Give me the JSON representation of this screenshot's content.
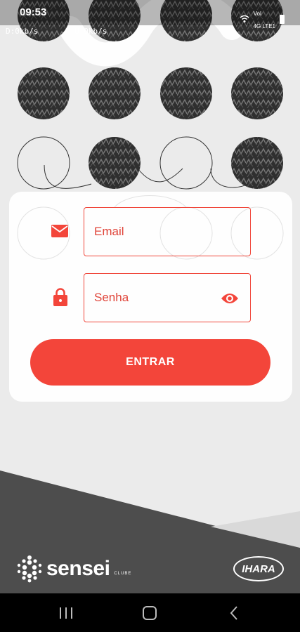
{
  "status_bar": {
    "time": "09:53",
    "network_label_top": "VoI",
    "network_label_bottom": "4G LTE1",
    "download_speed": "D:0kb/s",
    "upload_speed": "U:0kb/s"
  },
  "login_form": {
    "email_placeholder": "Email",
    "password_placeholder": "Senha",
    "submit_label": "ENTRAR"
  },
  "footer": {
    "sensei_logo_text": "sensei",
    "sensei_logo_sub": "CLUBE",
    "ihara_logo_text": "IHARA"
  },
  "colors": {
    "accent": "#f3453a",
    "footer_gray": "#4d4d4d",
    "background": "#ebebeb"
  },
  "icons": {
    "email": "mail-icon",
    "password": "lock-icon",
    "show_password": "eye-icon",
    "nav_recent": "recent-apps-icon",
    "nav_home": "home-icon",
    "nav_back": "back-icon"
  }
}
